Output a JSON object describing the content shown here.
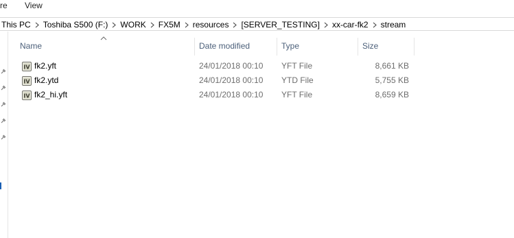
{
  "ribbon": {
    "tabs": [
      "re",
      "View"
    ]
  },
  "address_bar": {
    "crumbs": [
      "This PC",
      "Toshiba S500 (F:)",
      "WORK",
      "FX5M",
      "resources",
      "[SERVER_TESTING]",
      "xx-car-fk2",
      "stream"
    ]
  },
  "columns": {
    "name": "Name",
    "date_modified": "Date modified",
    "type": "Type",
    "size": "Size"
  },
  "files": [
    {
      "name": "fk2.yft",
      "date": "24/01/2018 00:10",
      "type": "YFT File",
      "size": "8,661 KB"
    },
    {
      "name": "fk2.ytd",
      "date": "24/01/2018 00:10",
      "type": "YTD File",
      "size": "5,755 KB"
    },
    {
      "name": "fk2_hi.yft",
      "date": "24/01/2018 00:10",
      "type": "YFT File",
      "size": "8,659 KB"
    }
  ],
  "icons": {
    "file": "iv-file-icon",
    "pin": "pin-icon",
    "separator": "chevron-right-icon",
    "sort": "sort-up-icon"
  }
}
